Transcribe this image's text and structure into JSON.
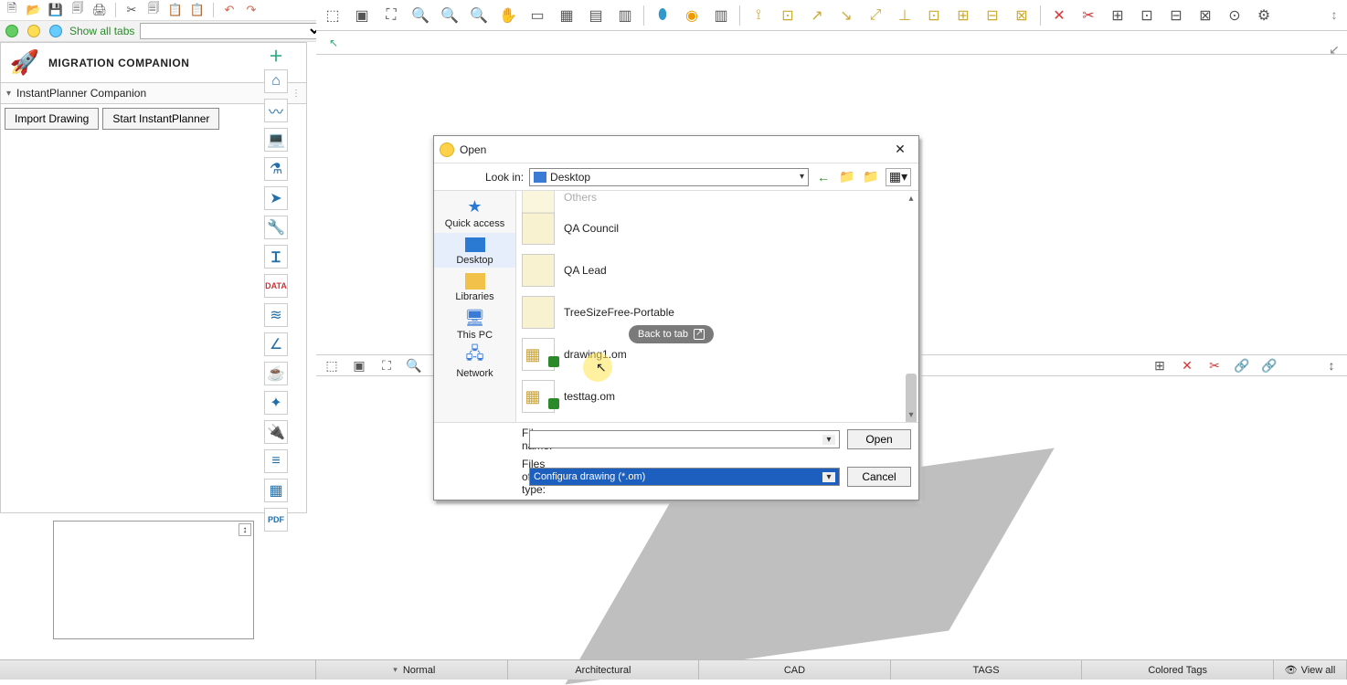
{
  "std_tools": [
    "new",
    "open",
    "save",
    "saveas",
    "print",
    "cut",
    "copy",
    "paste",
    "paste2",
    "undo",
    "redo"
  ],
  "tab": {
    "label": "Show all tabs"
  },
  "left": {
    "title": "MIGRATION COMPANION",
    "accordion": "InstantPlanner Companion",
    "btn_import": "Import Drawing",
    "btn_start": "Start InstantPlanner"
  },
  "rail_icons": [
    "plus",
    "home",
    "heart",
    "laptop",
    "flask",
    "rocket",
    "wrench",
    "ibeam",
    "data",
    "layers",
    "angle",
    "cup",
    "puzzle",
    "plug",
    "lines",
    "tools",
    "pdf"
  ],
  "main_tools": [
    "m1",
    "m2",
    "zoomfit",
    "zin",
    "zout",
    "zwin",
    "hand",
    "area",
    "crop",
    "page",
    "pageset",
    "drop",
    "eye",
    "sheet",
    "d1",
    "d2",
    "d3",
    "d4",
    "d5",
    "d6",
    "d7",
    "d8",
    "d9",
    "d10",
    "del",
    "sc1",
    "sc2",
    "sc3",
    "sc4",
    "sc5",
    "sc6",
    "sc7"
  ],
  "mid_left": [
    "m1",
    "m2",
    "zoomfit",
    "zin"
  ],
  "mid_right": [
    "mx",
    "del",
    "sc1",
    "sc2",
    "sc3"
  ],
  "dialog": {
    "title": "Open",
    "lookin_label": "Look in:",
    "lookin_value": "Desktop",
    "places": {
      "quick": "Quick access",
      "desktop": "Desktop",
      "libraries": "Libraries",
      "thispc": "This PC",
      "network": "Network"
    },
    "file_cut": "Others",
    "files": [
      {
        "name": "QA Council",
        "kind": "folder"
      },
      {
        "name": "QA Lead",
        "kind": "folder"
      },
      {
        "name": "TreeSizeFree-Portable",
        "kind": "folder"
      },
      {
        "name": "drawing1.om",
        "kind": "om"
      },
      {
        "name": "testtag.om",
        "kind": "om"
      }
    ],
    "filename_label": "File name:",
    "filename_value": "",
    "filetype_label": "Files of type:",
    "filetype_value": "Configura drawing (*.om)",
    "open_btn": "Open",
    "cancel_btn": "Cancel"
  },
  "back_pill": "Back to tab",
  "status": {
    "normal": "Normal",
    "arch": "Architectural",
    "cad": "CAD",
    "tags": "TAGS",
    "colored": "Colored Tags",
    "viewall": "View all"
  }
}
